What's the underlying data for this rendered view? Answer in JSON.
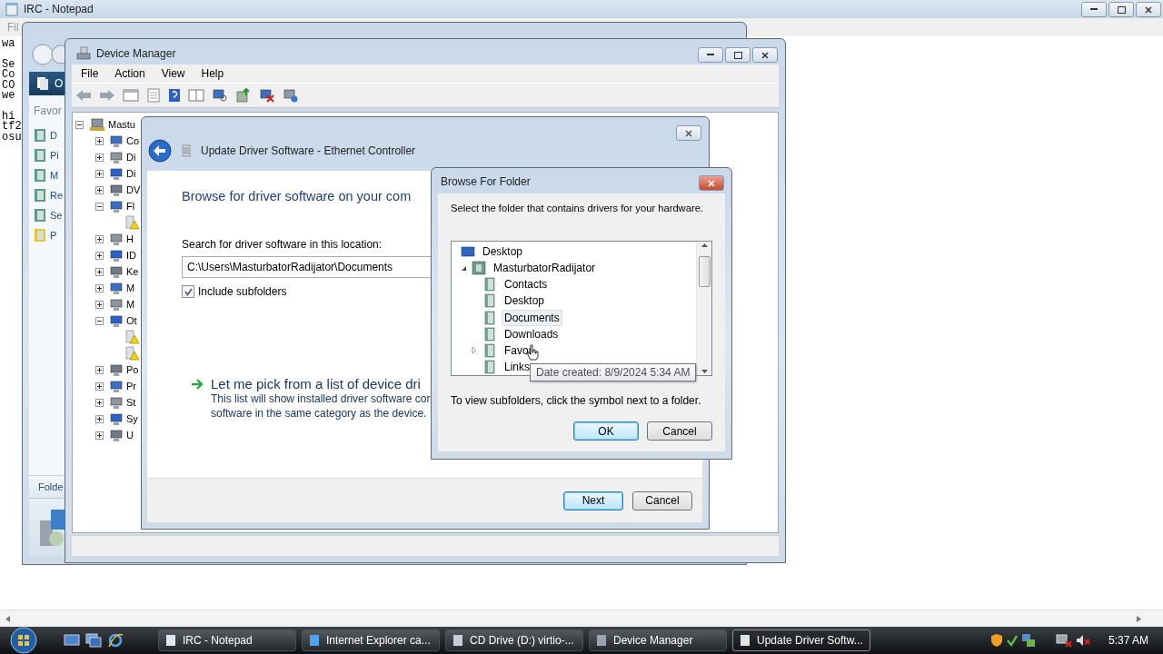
{
  "notepad": {
    "title": "IRC - Notepad",
    "menu": [
      "Fil"
    ],
    "paragraphs": [
      [
        "wa"
      ],
      [
        "Se",
        "Co",
        "CO",
        "we"
      ],
      [
        "hi",
        "tf2",
        "osu"
      ]
    ]
  },
  "explorer": {
    "organize_label": "O",
    "favorites_heading": "Favor",
    "links": [
      "D",
      "Pi",
      "M",
      "Re",
      "Se",
      "P"
    ],
    "folders_label": "Folde"
  },
  "device_manager": {
    "title": "Device Manager",
    "menu": [
      "File",
      "Action",
      "View",
      "Help"
    ],
    "tree": {
      "label": "Mastu",
      "expanded": true,
      "children": [
        {
          "label": "Co",
          "expanded": false
        },
        {
          "label": "Di",
          "expanded": false
        },
        {
          "label": "Di",
          "expanded": false
        },
        {
          "label": "DV",
          "expanded": false
        },
        {
          "label": "Fl",
          "expanded": true,
          "children": [
            {
              "warning": true
            }
          ]
        },
        {
          "label": "H",
          "expanded": false
        },
        {
          "label": "ID",
          "expanded": false
        },
        {
          "label": "Ke",
          "expanded": false
        },
        {
          "label": "M",
          "expanded": false
        },
        {
          "label": "M",
          "expanded": false
        },
        {
          "label": "Ot",
          "expanded": true,
          "children": [
            {
              "warning": true
            },
            {
              "warning": true
            }
          ]
        },
        {
          "label": "Po",
          "expanded": false
        },
        {
          "label": "Pr",
          "expanded": false
        },
        {
          "label": "St",
          "expanded": false
        },
        {
          "label": "Sy",
          "expanded": false
        },
        {
          "label": "U",
          "expanded": false
        }
      ]
    }
  },
  "update_driver": {
    "title": "Update Driver Software - Ethernet Controller",
    "heading": "Browse for driver software on your com",
    "location_label": "Search for driver software in this location:",
    "location_value": "C:\\Users\\MasturbatorRadijator\\Documents",
    "include_subfolders": {
      "label": "Include subfolders",
      "checked": true
    },
    "pick": {
      "title": "Let me pick from a list of device dri",
      "description": [
        "This list will show installed driver software cor",
        "software in the same category as the device."
      ]
    },
    "buttons": [
      {
        "label": "Next",
        "default": true
      },
      {
        "label": "Cancel",
        "default": false
      }
    ]
  },
  "browse": {
    "title": "Browse For Folder",
    "instruction": "Select the folder that contains drivers for your hardware.",
    "tree": [
      {
        "label": "Desktop",
        "kind": "desktop"
      },
      {
        "label": "MasturbatorRadijator",
        "kind": "user",
        "expanded": true,
        "children": [
          {
            "label": "Contacts",
            "selected": false
          },
          {
            "label": "Desktop",
            "selected": false
          },
          {
            "label": "Documents",
            "selected": true
          },
          {
            "label": "Downloads",
            "selected": false
          },
          {
            "label": "Favor",
            "selected": false,
            "expanded": false
          },
          {
            "label": "Links",
            "selected": false
          }
        ]
      }
    ],
    "tooltip": "Date created: 8/9/2024 5:34 AM",
    "hint": "To view subfolders, click the symbol next to a folder.",
    "buttons": [
      {
        "label": "OK",
        "default": true
      },
      {
        "label": "Cancel",
        "default": false
      }
    ]
  },
  "taskbar": {
    "tasks": [
      {
        "label": "IRC - Notepad",
        "selected": false
      },
      {
        "label": "Internet Explorer ca...",
        "selected": false
      },
      {
        "label": "CD Drive (D:) virtio-...",
        "selected": false
      },
      {
        "label": "Device Manager",
        "selected": false
      },
      {
        "label": "Update Driver Softw...",
        "selected": true
      }
    ],
    "clock": "5:37 AM"
  }
}
